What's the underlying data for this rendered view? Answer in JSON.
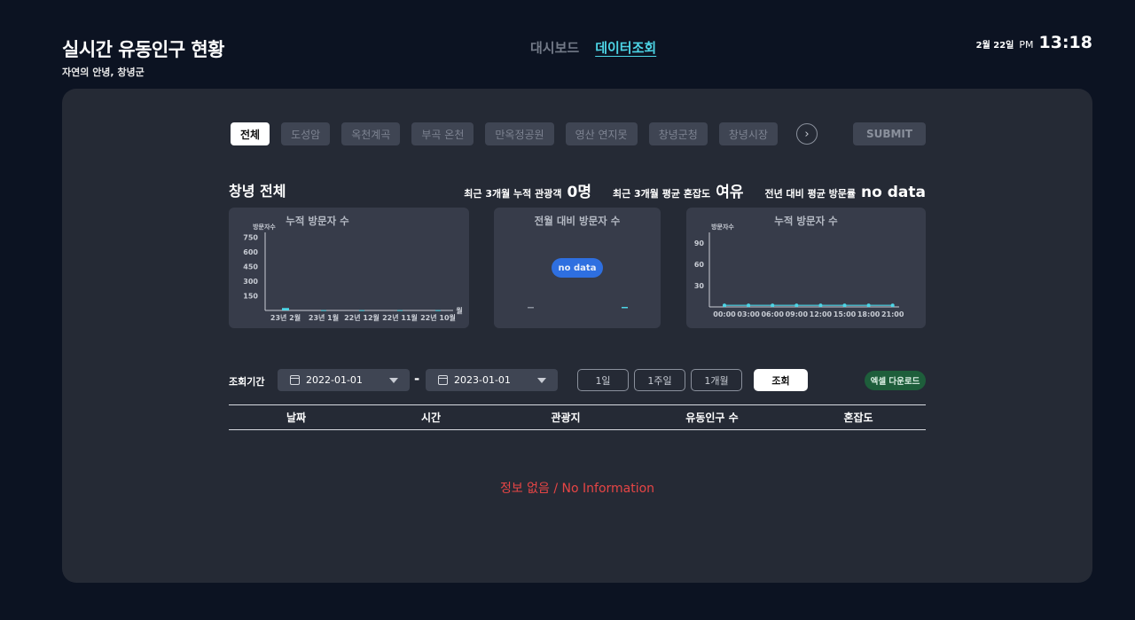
{
  "header": {
    "title": "실시간 유동인구 현황",
    "subtitle": "자연의 안녕, 창녕군",
    "nav": {
      "dashboard": "대시보드",
      "data_query": "데이터조회"
    },
    "clock": {
      "date": "2월 22일",
      "ampm": "PM",
      "time": "13:18"
    }
  },
  "chips": [
    "전체",
    "도성암",
    "옥천계곡",
    "부곡 온천",
    "만옥정공원",
    "영산 연지못",
    "창녕군청",
    "창녕시장"
  ],
  "submit_label": "SUBMIT",
  "summary": {
    "title": "창녕 전체",
    "stats": [
      {
        "label": "최근 3개월 누적 관광객",
        "value": "0명"
      },
      {
        "label": "최근 3개월 평균 혼잡도",
        "value": "여유"
      },
      {
        "label": "전년 대비 평균 방문률",
        "value": "no data"
      }
    ]
  },
  "chart_data": [
    {
      "type": "bar",
      "title": "누적 방문자 수",
      "ylabel": "방문자수",
      "xlabel": "월",
      "yticks": [
        150,
        300,
        450,
        600,
        750
      ],
      "ylim": [
        0,
        800
      ],
      "categories": [
        "23년 2월",
        "23년 1월",
        "22년 12월",
        "22년 11월",
        "22년 10월"
      ],
      "values": [
        25,
        3,
        3,
        3,
        3
      ]
    },
    {
      "type": "bar",
      "title": "전월 대비 방문자 수",
      "badge": "no data",
      "categories": [
        "",
        ""
      ],
      "values": [
        0,
        0
      ]
    },
    {
      "type": "line",
      "title": "누적 방문자 수",
      "ylabel": "방문자수",
      "yticks": [
        30,
        60,
        90
      ],
      "ylim": [
        0,
        105
      ],
      "x": [
        "00:00",
        "03:00",
        "06:00",
        "09:00",
        "12:00",
        "15:00",
        "18:00",
        "21:00"
      ],
      "values": [
        1,
        1,
        1,
        1,
        1,
        1,
        1,
        1
      ]
    }
  ],
  "query": {
    "label": "조회기간",
    "start_date": "2022-01-01",
    "end_date": "2023-01-01",
    "range_separator": "-",
    "periods": [
      "1일",
      "1주일",
      "1개월"
    ],
    "search_label": "조회",
    "excel_label": "엑셀 다운로드"
  },
  "table": {
    "columns": [
      "날짜",
      "시간",
      "관광지",
      "유동인구 수",
      "혼잡도"
    ],
    "empty_message": "정보 없음 / No Information"
  },
  "colors": {
    "accent": "#4dd5e6",
    "badge_blue": "#2e6fe0",
    "excel_green": "#1e5e3b",
    "error_red": "#e64545"
  }
}
